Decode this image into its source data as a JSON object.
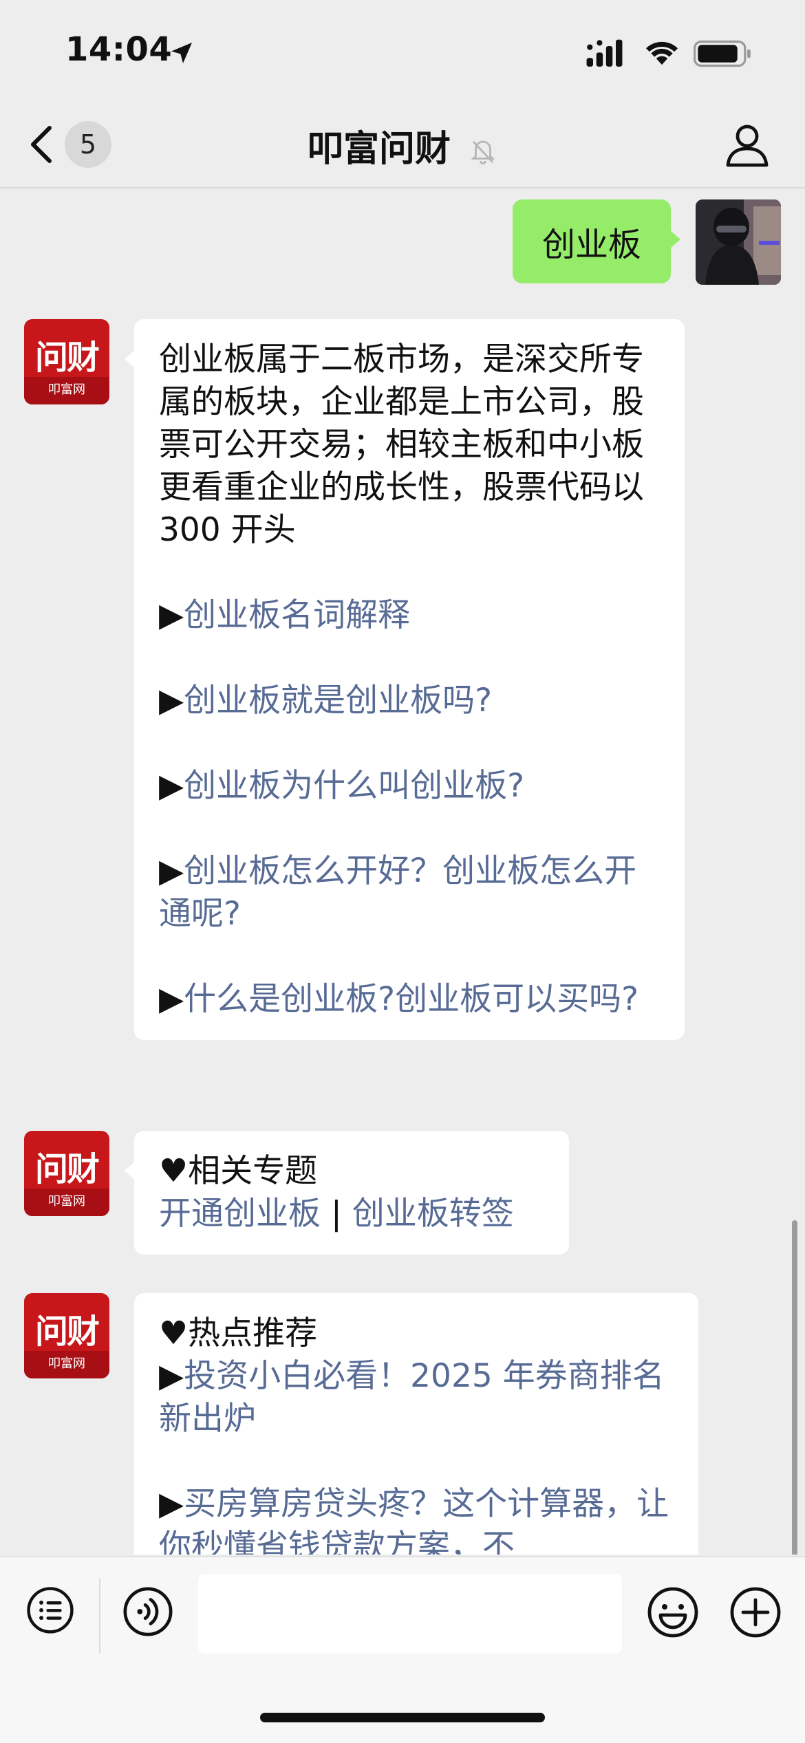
{
  "status_bar": {
    "time": "14:04",
    "icons": [
      "location-arrow-icon",
      "signal-icon",
      "wifi-icon",
      "battery-icon"
    ]
  },
  "nav": {
    "back_icon": "chevron-left-icon",
    "unread_count": "5",
    "title": "叩富问财",
    "title_icon": "bell-muted-icon",
    "right_icon": "person-icon"
  },
  "messages": {
    "user_message": "创业板",
    "bot1": {
      "intro": "创业板属于二板市场，是深交所专属的板块，企业都是上市公司，股票可公开交易；相较主板和中小板更看重企业的成长性，股票代码以 300 开头",
      "bullet": "▶",
      "links": [
        "创业板名词解释",
        "创业板就是创业板吗?",
        "创业板为什么叫创业板?",
        "创业板怎么开好？创业板怎么开通呢?",
        "什么是创业板?创业板可以买吗?"
      ]
    },
    "bot2": {
      "heading": "♥相关专题",
      "link1": "开通创业板",
      "separator": " | ",
      "link2": "创业板转签"
    },
    "bot3": {
      "heading": "♥热点推荐",
      "bullet": "▶",
      "link1": "投资小白必看！2025 年券商排名新出炉",
      "link2": "买房算房贷头疼？这个计算器，让你秒懂省钱贷款方案，不"
    }
  },
  "bot_avatar": {
    "logo_text": "问财",
    "logo_sub": "叩富网"
  },
  "input_bar": {
    "icons": [
      "menu-list-icon",
      "voice-icon",
      "emoji-icon",
      "plus-icon"
    ],
    "input_value": ""
  },
  "colors": {
    "background": "#ededed",
    "user_bubble": "#95ec69",
    "link": "#576b95",
    "brand_red": "#c7171b"
  }
}
